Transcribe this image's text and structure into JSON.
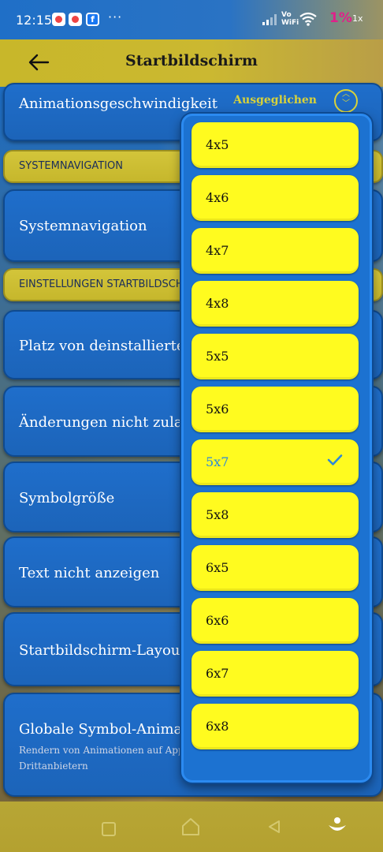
{
  "status_bar": {
    "time": "12:15",
    "dots": "···",
    "vowifi": "Vo\nWiFi",
    "battery": "1%",
    "charging": "1x"
  },
  "header": {
    "title": "Startbildschirm"
  },
  "settings": {
    "animation_speed": {
      "label": "Animationsgeschwindigkeit",
      "value": "Ausgeglichen"
    },
    "section_system_nav": "SYSTEMNAVIGATION",
    "system_nav": "Systemnavigation",
    "section_home_settings": "EINSTELLUNGEN STARTBILDSCHIRM",
    "uninstalled_space": "Platz von deinstallierten Apps füllen",
    "disallow_changes": "Änderungen nicht zulassen",
    "icon_size": "Symbolgröße",
    "hide_text": "Text nicht anzeigen",
    "home_layout": "Startbildschirm-Layout",
    "global_icon_anim": {
      "label": "Globale Symbol-Animationen",
      "subtitle_line1": "Rendern von Animationen auf Apps von",
      "subtitle_line2": "Drittanbietern"
    }
  },
  "layout_options": {
    "items": [
      "4x5",
      "4x6",
      "4x7",
      "4x8",
      "5x5",
      "5x6",
      "5x7",
      "5x8",
      "6x5",
      "6x6",
      "6x7",
      "6x8"
    ],
    "selected": "5x7"
  },
  "colors": {
    "card_blue": "#1f6ecb",
    "section_yellow": "#d3c53a",
    "option_yellow": "#fffb1f",
    "selected_text": "#2d88d9",
    "value_accent": "#d8d23a"
  }
}
